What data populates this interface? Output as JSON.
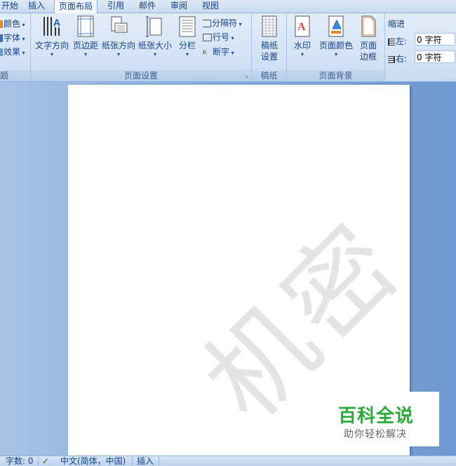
{
  "tabs": [
    "开始",
    "插入",
    "页面布局",
    "引用",
    "邮件",
    "审阅",
    "视图"
  ],
  "active_tab": "页面布局",
  "theme_group": {
    "items": [
      "颜色",
      "字体",
      "效果"
    ],
    "label_fragment": "题"
  },
  "page_setup": {
    "buttons": [
      "文字方向",
      "页边距",
      "纸张方向",
      "纸张大小",
      "分栏"
    ],
    "small_buttons": [
      "分隔符",
      "行号",
      "断字"
    ],
    "label": "页面设置"
  },
  "manuscript": {
    "button_line1": "稿纸",
    "button_line2": "设置",
    "label": "稿纸"
  },
  "page_background": {
    "buttons": [
      "水印",
      "页面颜色"
    ],
    "border_line1": "页面",
    "border_line2": "边框",
    "label": "页面背景"
  },
  "indent": {
    "title": "缩进",
    "left_label": "左:",
    "left_value": "0 字符",
    "right_label": "右:",
    "right_value": "0 字符"
  },
  "document": {
    "watermark_text": "机密"
  },
  "logo": {
    "main": "百科全说",
    "sub": "助你轻松解决"
  },
  "statusbar": {
    "word_count": "字数: 0",
    "language": "中文(简体，中国)",
    "mode": "插入"
  },
  "colors": {
    "accent": "#15428b",
    "logo_green": "#2eaa3c"
  }
}
